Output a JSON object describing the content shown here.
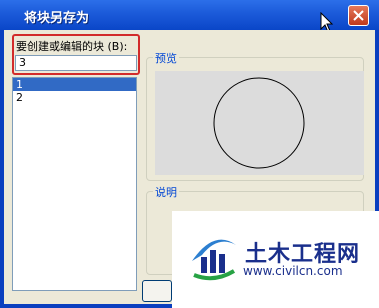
{
  "window": {
    "title": "将块另存为"
  },
  "block_field": {
    "label": "要创建或编辑的块 (B):",
    "value": "3"
  },
  "block_list": {
    "items": [
      "1",
      "2"
    ],
    "selected_index": 0
  },
  "preview": {
    "label": "预览"
  },
  "description": {
    "label": "说明"
  },
  "watermark": {
    "brand": "土木工程网",
    "url": "www.civilcn.com"
  },
  "colors": {
    "titlebar": "#0a46c8",
    "client_bg": "#ece9d8",
    "group_label": "#0046d5",
    "selection": "#316ac5",
    "highlight": "#d22b2b"
  }
}
